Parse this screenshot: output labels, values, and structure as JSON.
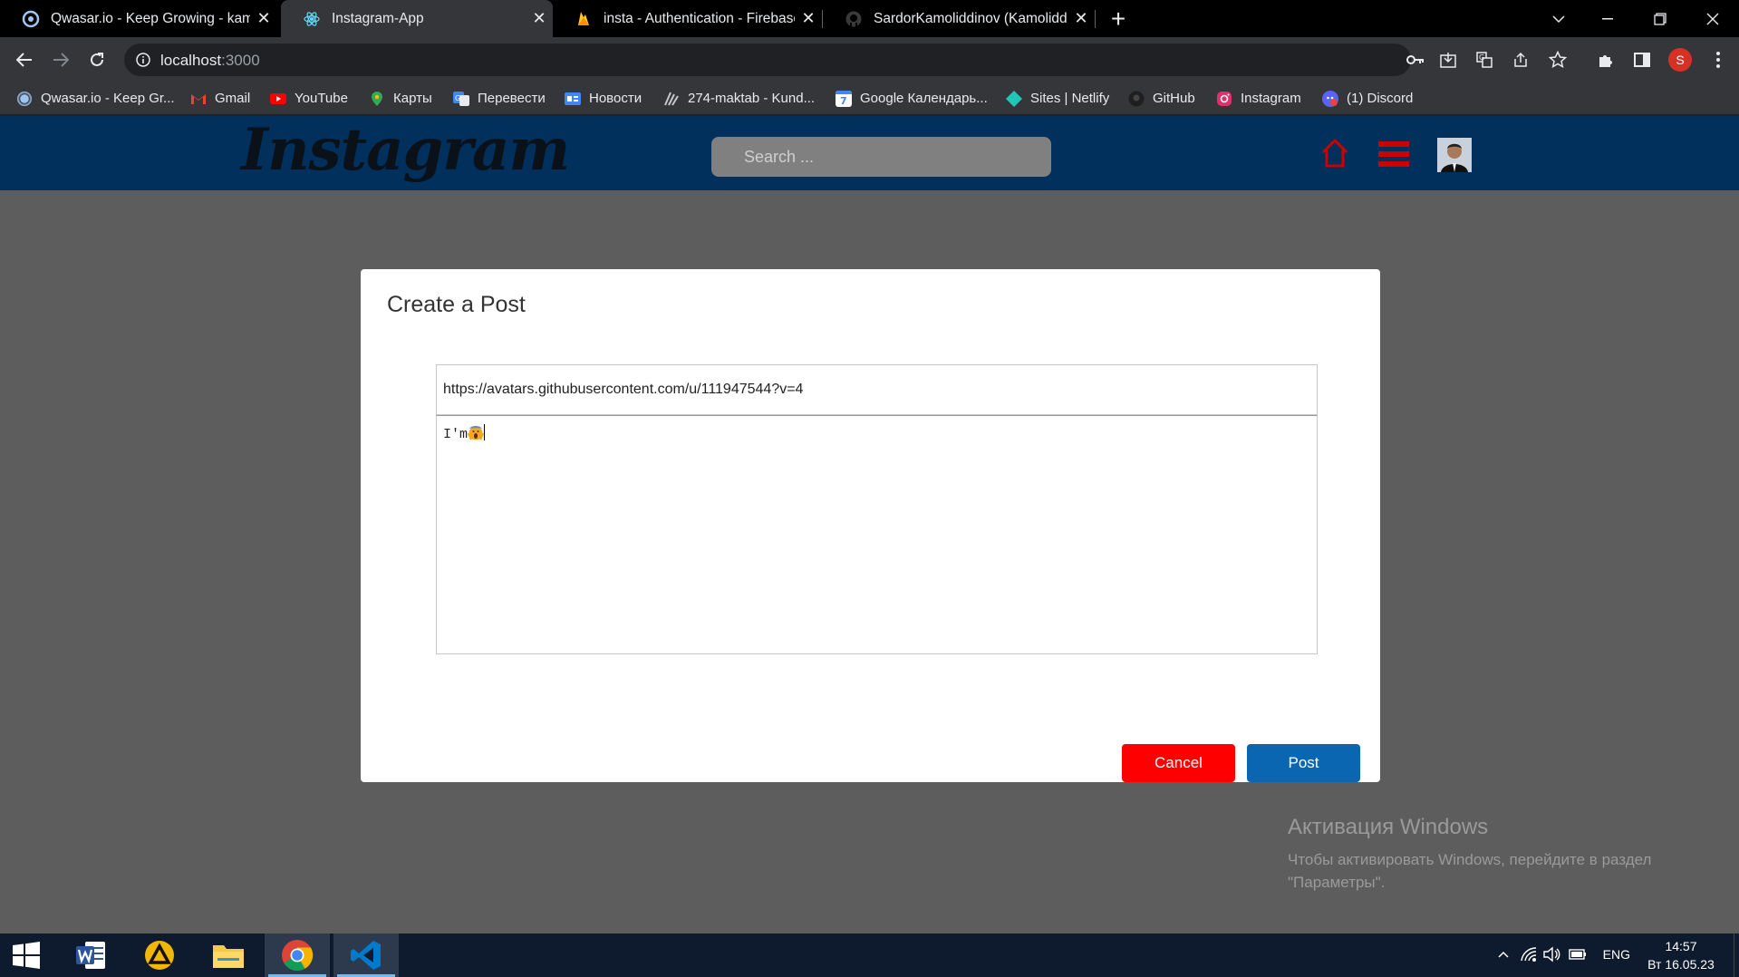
{
  "browser": {
    "tabs": [
      {
        "title": "Qwasar.io - Keep Growing - kam",
        "active": false
      },
      {
        "title": "Instagram-App",
        "active": true
      },
      {
        "title": "insta - Authentication - Firebase",
        "active": false
      },
      {
        "title": "SardorKamoliddinov (Kamoliddin",
        "active": false
      }
    ],
    "url_host": "localhost",
    "url_port": ":3000",
    "profile_initial": "S",
    "bookmarks": [
      "Qwasar.io - Keep Gr...",
      "Gmail",
      "YouTube",
      "Карты",
      "Перевести",
      "Новости",
      "274-maktab - Kund...",
      "Google Календарь...",
      "Sites | Netlify",
      "GitHub",
      "Instagram",
      "(1) Discord"
    ]
  },
  "app": {
    "logo": "Instagram",
    "search_placeholder": "Search ..."
  },
  "modal": {
    "title": "Create a Post",
    "image_url": "https://avatars.githubusercontent.com/u/111947544?v=4",
    "caption_text": "I'm",
    "cancel_label": "Cancel",
    "post_label": "Post"
  },
  "watermark": {
    "title": "Активация Windows",
    "line": "Чтобы активировать Windows, перейдите в раздел \"Параметры\"."
  },
  "taskbar": {
    "language": "ENG",
    "time": "14:57",
    "date": "Вт 16.05.23"
  },
  "colors": {
    "app_bar": "#00305b",
    "cancel_button": "#ff0000",
    "post_button": "#0a66b0",
    "icon_red": "#cc0000"
  }
}
